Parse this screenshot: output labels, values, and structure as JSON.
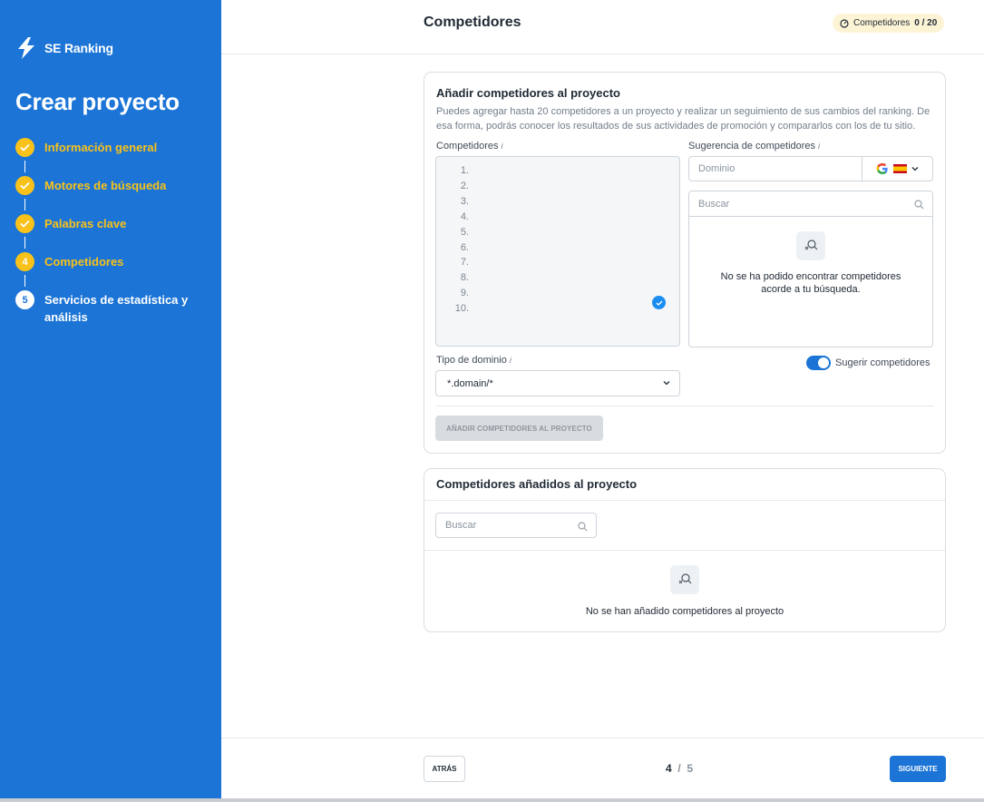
{
  "brand": {
    "name": "SE Ranking"
  },
  "sidebar": {
    "title": "Crear proyecto",
    "steps": [
      {
        "label": "Información general",
        "state": "done"
      },
      {
        "label": "Motores de búsqueda",
        "state": "done"
      },
      {
        "label": "Palabras clave",
        "state": "done"
      },
      {
        "label": "Competidores",
        "state": "active",
        "number": "4"
      },
      {
        "label": "Servicios de estadística y análisis",
        "state": "pending",
        "number": "5"
      }
    ]
  },
  "header": {
    "title": "Competidores",
    "badge_label": "Competidores",
    "badge_value": "0 / 20"
  },
  "add_card": {
    "title": "Añadir competidores al proyecto",
    "description": "Puedes agregar hasta 20 competidores a un proyecto y realizar un seguimiento de sus cambios del ranking. De esa forma, podrás conocer los resultados de sus actividades de promoción y compararlos con los de tu sitio.",
    "competitors_label": "Competidores",
    "line_numbers": [
      "1.",
      "2.",
      "3.",
      "4.",
      "5.",
      "6.",
      "7.",
      "8.",
      "9.",
      "10."
    ],
    "suggestion_label": "Sugerencia de competidores",
    "domain_placeholder": "Dominio",
    "search_placeholder": "Buscar",
    "empty_suggestions": "No se ha podido encontrar competidores acorde a tu búsqueda.",
    "domain_type_label": "Tipo de dominio",
    "domain_type_value": "*.domain/*",
    "suggest_toggle_label": "Sugerir competidores",
    "suggest_toggle_on": true,
    "add_button": "AÑADIR COMPETIDORES AL PROYECTO",
    "info_mark": "i"
  },
  "added_card": {
    "title": "Competidores añadidos al proyecto",
    "search_placeholder": "Buscar",
    "empty_text": "No se han añadido competidores al proyecto"
  },
  "footer": {
    "back_button": "ATRÁS",
    "current_step": "4",
    "separator": "/",
    "total_steps": "5",
    "next_button": "SIGUIENTE"
  },
  "colors": {
    "sidebar_bg": "#1b74d6",
    "step_done": "#f8c21a",
    "primary": "#1b74d6"
  }
}
